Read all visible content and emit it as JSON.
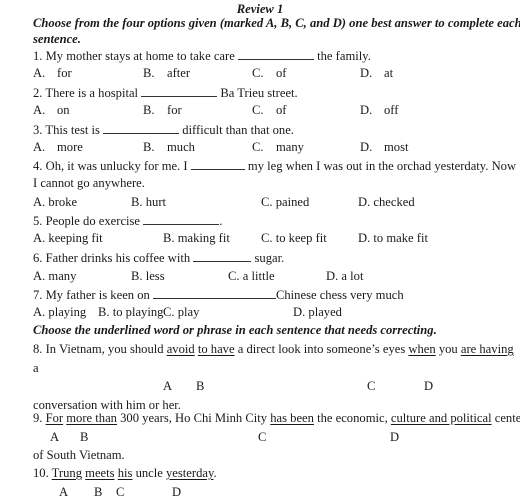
{
  "title": "Review 1",
  "section1": {
    "instruction_line1": "Choose from the four options given (marked A, B, C, and D) one best answer to complete each",
    "instruction_line2": "sentence."
  },
  "questions": [
    {
      "num": "1.",
      "before": "My mother stays at home to take care",
      "after": "the family.",
      "options": [
        {
          "letter": "A.",
          "text": "for"
        },
        {
          "letter": "B.",
          "text": "after"
        },
        {
          "letter": "C.",
          "text": "of"
        },
        {
          "letter": "D.",
          "text": "at"
        }
      ]
    },
    {
      "num": "2.",
      "before": "There is a hospital",
      "after": "Ba Trieu street.",
      "options": [
        {
          "letter": "A.",
          "text": "on"
        },
        {
          "letter": "B.",
          "text": "for"
        },
        {
          "letter": "C.",
          "text": "of"
        },
        {
          "letter": "D.",
          "text": "off"
        }
      ]
    },
    {
      "num": "3.",
      "before": "This test is",
      "after": "difficult than that one.",
      "options": [
        {
          "letter": "A.",
          "text": "more"
        },
        {
          "letter": "B.",
          "text": "much"
        },
        {
          "letter": "C.",
          "text": "many"
        },
        {
          "letter": "D.",
          "text": "most"
        }
      ]
    },
    {
      "num": "4.",
      "before": "Oh, it was unlucky for me. I",
      "after": "my leg when I was out in the orchad yesterdaty. Now",
      "continuation": "I cannot go anywhere.",
      "options": [
        {
          "letter": "A.",
          "text": "broke"
        },
        {
          "letter": "B.",
          "text": "hurt"
        },
        {
          "letter": "C.",
          "text": "pained"
        },
        {
          "letter": "D.",
          "text": "checked"
        }
      ]
    },
    {
      "num": "5.",
      "before": "People do exercise",
      "after": ".",
      "options": [
        {
          "letter": "A.",
          "text": "keeping fit"
        },
        {
          "letter": "B.",
          "text": "making fit"
        },
        {
          "letter": "C.",
          "text": "to keep fit"
        },
        {
          "letter": "D.",
          "text": "to make fit"
        }
      ]
    },
    {
      "num": "6.",
      "before": "Father drinks his coffee with",
      "after": "sugar.",
      "options": [
        {
          "letter": "A.",
          "text": "many"
        },
        {
          "letter": "B.",
          "text": "less"
        },
        {
          "letter": "C.",
          "text": "a little"
        },
        {
          "letter": "D.",
          "text": "a lot"
        }
      ]
    },
    {
      "num": "7.",
      "before": "My father is keen on",
      "after": "Chinese chess very much",
      "options": [
        {
          "letter": "A.",
          "text": "playing"
        },
        {
          "letter": "B.",
          "text": "to playing"
        },
        {
          "letter": "C.",
          "text": "play"
        },
        {
          "letter": "D.",
          "text": "played"
        }
      ]
    }
  ],
  "section2": {
    "instruction": "Choose the underlined word or phrase in each sentence that needs correcting."
  },
  "error_questions": [
    {
      "num": "8.",
      "parts": [
        "In Vietnam, you should ",
        "avoid",
        " ",
        "to have",
        " a direct look into someone’s eyes ",
        "when",
        " you ",
        "are having"
      ],
      "line2": "a",
      "line3": "conversation with him or her.",
      "labels": [
        "A",
        "B",
        "C",
        "D"
      ]
    },
    {
      "num": "9.",
      "parts": [
        " ",
        "For",
        " ",
        "more than",
        " 300 years, Ho Chi Minh City ",
        "has been",
        " the economic, ",
        "culture and political",
        " center"
      ],
      "line2": "of South Vietnam.",
      "labels": [
        "A",
        "B",
        "C",
        "D"
      ]
    },
    {
      "num": "10.",
      "parts": [
        " ",
        "Trung",
        " ",
        "meets",
        " ",
        "his",
        " uncle ",
        "yesterday",
        "."
      ],
      "labels": [
        "A",
        "B",
        "C",
        "D"
      ]
    }
  ]
}
